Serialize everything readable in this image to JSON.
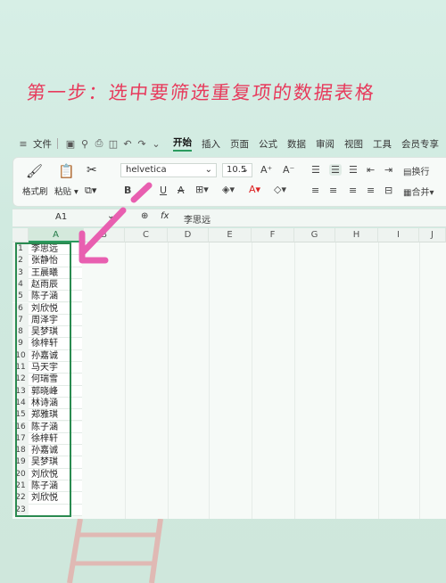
{
  "headline": "第一步：选中要筛选重复项的数据表格",
  "menubar": {
    "file": "文件",
    "tabs": [
      "开始",
      "插入",
      "页面",
      "公式",
      "数据",
      "审阅",
      "视图",
      "工具",
      "会员专享"
    ],
    "active_tab": "开始"
  },
  "ribbon": {
    "format_painter": "格式刷",
    "paste": "粘贴",
    "font_name": "helvetica",
    "font_size": "10.5",
    "wrap": "换行",
    "merge": "合并"
  },
  "formula_bar": {
    "name_box": "A1",
    "fx": "fx",
    "content": "李思远"
  },
  "grid": {
    "columns": [
      "A",
      "B",
      "C",
      "D",
      "E",
      "F",
      "G",
      "H",
      "I",
      "J"
    ],
    "rows": [
      "1",
      "2",
      "3",
      "4",
      "5",
      "6",
      "7",
      "8",
      "9",
      "10",
      "11",
      "12",
      "13",
      "14",
      "15",
      "16",
      "17",
      "18",
      "19",
      "20",
      "21",
      "22",
      "23"
    ],
    "cells_A": [
      "李思远",
      "张静怡",
      "王晨曦",
      "赵雨辰",
      "陈子涵",
      "刘欣悦",
      "周泽宇",
      "吴梦琪",
      "徐梓轩",
      "孙嘉诚",
      "马天宇",
      "何瑞雪",
      "郭晓峰",
      "林诗涵",
      "郑雅琪",
      "陈子涵",
      "徐梓轩",
      "孙嘉诚",
      "吴梦琪",
      "刘欣悦",
      "陈子涵",
      "刘欣悦",
      ""
    ]
  },
  "colors": {
    "accent": "#2a9b5e",
    "headline": "#e73a5c",
    "arrow": "#e85fb0"
  }
}
